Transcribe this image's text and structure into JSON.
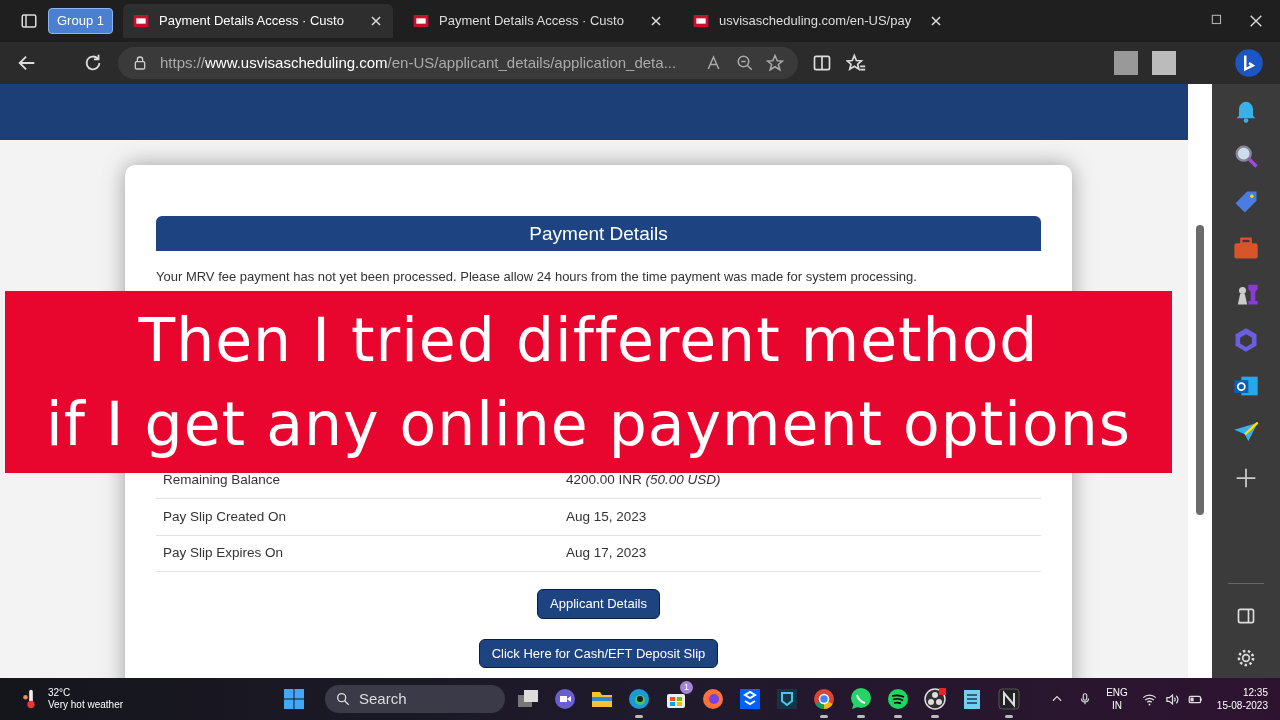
{
  "browser": {
    "tab_group": "Group 1",
    "tabs": [
      {
        "title": "Payment Details Access  · Custo",
        "selected": true
      },
      {
        "title": "Payment Details Access  · Custo",
        "selected": false
      },
      {
        "title": "usvisascheduling.com/en-US/pay",
        "selected": false
      }
    ],
    "url": {
      "scheme": "https://",
      "domain": "www.usvisascheduling.com",
      "path": "/en-US/applicant_details/application_deta..."
    }
  },
  "page": {
    "panel_title": "Payment Details",
    "notice": "Your MRV fee payment has not yet been processed. Please allow 24 hours from the time payment was made for system processing.",
    "rows": [
      {
        "label": "Remaining Balance",
        "value": "4200.00 INR *(50.00 USD)*"
      },
      {
        "label": "Pay Slip Created On",
        "value": "Aug 15, 2023"
      },
      {
        "label": "Pay Slip Expires On",
        "value": "Aug 17, 2023"
      }
    ],
    "buttons": [
      "Applicant Details",
      "Click Here for Cash/EFT Deposit Slip"
    ]
  },
  "caption": {
    "lines": [
      "Then I tried different method",
      "if I get any online payment options"
    ]
  },
  "sidebar": {
    "items": [
      {
        "kind": "bell"
      },
      {
        "kind": "search"
      },
      {
        "kind": "tag"
      },
      {
        "kind": "toolbox"
      },
      {
        "kind": "chess"
      },
      {
        "kind": "hexagon"
      },
      {
        "kind": "mail"
      },
      {
        "kind": "plane"
      },
      {
        "kind": "plus"
      }
    ]
  },
  "taskbar": {
    "weather": {
      "temperature": "32°C",
      "description": "Very hot weather"
    },
    "search": "Search",
    "apps": [
      {
        "kind": "windows",
        "running": false
      },
      {
        "kind": "desktops",
        "running": false
      },
      {
        "kind": "meet",
        "running": false
      },
      {
        "kind": "folder",
        "running": false
      },
      {
        "kind": "edge",
        "running": true
      },
      {
        "kind": "store",
        "running": false,
        "badge": "1"
      },
      {
        "kind": "fox",
        "running": false
      },
      {
        "kind": "box",
        "running": false
      },
      {
        "kind": "shield",
        "running": false
      },
      {
        "kind": "chrome",
        "running": true
      },
      {
        "kind": "chat",
        "running": true
      },
      {
        "kind": "music",
        "running": true
      },
      {
        "kind": "record",
        "running": true
      },
      {
        "kind": "notepad",
        "running": false
      },
      {
        "kind": "letter",
        "running": true
      }
    ],
    "tray": {
      "language": "ENG",
      "region": "IN",
      "time": "12:35",
      "date": "15-08-2023"
    }
  }
}
